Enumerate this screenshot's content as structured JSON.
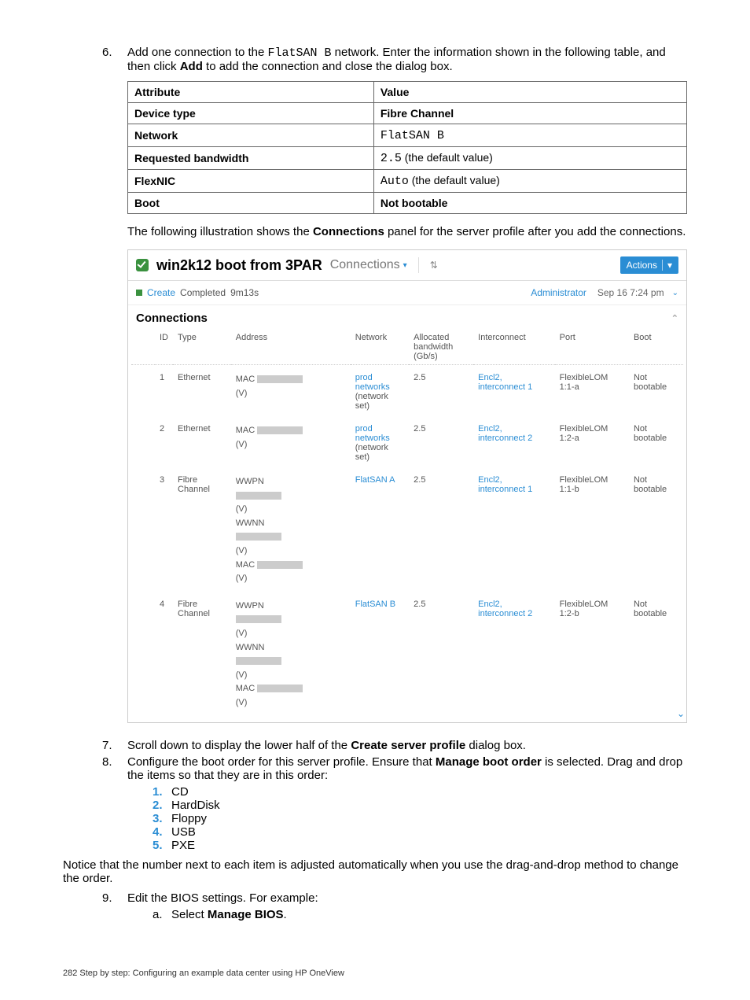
{
  "steps": {
    "s6": {
      "num": "6.",
      "text_parts": [
        "Add one connection to the ",
        " network. Enter the information shown in the following table, and then click ",
        " to add the connection and close the dialog box."
      ],
      "code": "FlatSAN B",
      "bold": "Add"
    },
    "s7": {
      "num": "7.",
      "text_a": "Scroll down to display the lower half of the ",
      "bold": "Create server profile",
      "text_b": " dialog box."
    },
    "s8": {
      "num": "8.",
      "text_a": "Configure the boot order for this server profile. Ensure that ",
      "bold": "Manage boot order",
      "text_b": " is selected. Drag and drop the items so that they are in this order:"
    },
    "s8_note": "Notice that the number next to each item is adjusted automatically when you use the drag-and-drop method to change the order.",
    "s9": {
      "num": "9.",
      "text": "Edit the BIOS settings. For example:"
    },
    "s9a": {
      "letter": "a.",
      "pre": "Select ",
      "bold": "Manage BIOS",
      "post": "."
    }
  },
  "boot_order": [
    {
      "n": "1.",
      "label": "CD"
    },
    {
      "n": "2.",
      "label": "HardDisk"
    },
    {
      "n": "3.",
      "label": "Floppy"
    },
    {
      "n": "4.",
      "label": "USB"
    },
    {
      "n": "5.",
      "label": "PXE"
    }
  ],
  "attr_table": {
    "head_attr": "Attribute",
    "head_val": "Value",
    "rows": [
      {
        "attr": "Device type",
        "val_bold": "Fibre Channel",
        "val_code": "",
        "val_suffix": ""
      },
      {
        "attr": "Network",
        "val_bold": "",
        "val_code": "FlatSAN B",
        "val_suffix": ""
      },
      {
        "attr": "Requested bandwidth",
        "val_bold": "",
        "val_code": "2.5",
        "val_suffix": " (the default value)"
      },
      {
        "attr": "FlexNIC",
        "val_bold": "",
        "val_code": "Auto",
        "val_suffix": " (the default value)"
      },
      {
        "attr": "Boot",
        "val_bold": "Not bootable",
        "val_code": "",
        "val_suffix": ""
      }
    ]
  },
  "illus_caption_a": "The following illustration shows the ",
  "illus_caption_bold": "Connections",
  "illus_caption_b": " panel for the server profile after you add the connections.",
  "shot": {
    "title": "win2k12 boot from 3PAR",
    "section": "Connections",
    "actions": "Actions",
    "status": {
      "create": "Create",
      "completed": "Completed",
      "time": "9m13s",
      "user": "Administrator",
      "date": "Sep 16 7:24 pm"
    },
    "conn_heading": "Connections",
    "columns": {
      "id": "ID",
      "type": "Type",
      "address": "Address",
      "network": "Network",
      "bw": "Allocated bandwidth (Gb/s)",
      "interconnect": "Interconnect",
      "port": "Port",
      "boot": "Boot"
    },
    "rows": [
      {
        "id": "1",
        "type": "Ethernet",
        "addr": [
          "MAC",
          "(V)"
        ],
        "network": "prod networks",
        "network2": "(network set)",
        "bw": "2.5",
        "ic": "Encl2, interconnect 1",
        "port": "FlexibleLOM 1:1-a",
        "boot": "Not bootable"
      },
      {
        "id": "2",
        "type": "Ethernet",
        "addr": [
          "MAC",
          "(V)"
        ],
        "network": "prod networks",
        "network2": "(network set)",
        "bw": "2.5",
        "ic": "Encl2, interconnect 2",
        "port": "FlexibleLOM 1:2-a",
        "boot": "Not bootable"
      },
      {
        "id": "3",
        "type": "Fibre Channel",
        "addr": [
          "WWPN",
          "(V)",
          "WWNN",
          "(V)",
          "MAC",
          "(V)"
        ],
        "network": "FlatSAN A",
        "network2": "",
        "bw": "2.5",
        "ic": "Encl2, interconnect 1",
        "port": "FlexibleLOM 1:1-b",
        "boot": "Not bootable"
      },
      {
        "id": "4",
        "type": "Fibre Channel",
        "addr": [
          "WWPN",
          "(V)",
          "WWNN",
          "(V)",
          "MAC",
          "(V)"
        ],
        "network": "FlatSAN B",
        "network2": "",
        "bw": "2.5",
        "ic": "Encl2, interconnect 2",
        "port": "FlexibleLOM 1:2-b",
        "boot": "Not bootable"
      }
    ]
  },
  "footer": "282   Step by step: Configuring an example data center using HP OneView"
}
